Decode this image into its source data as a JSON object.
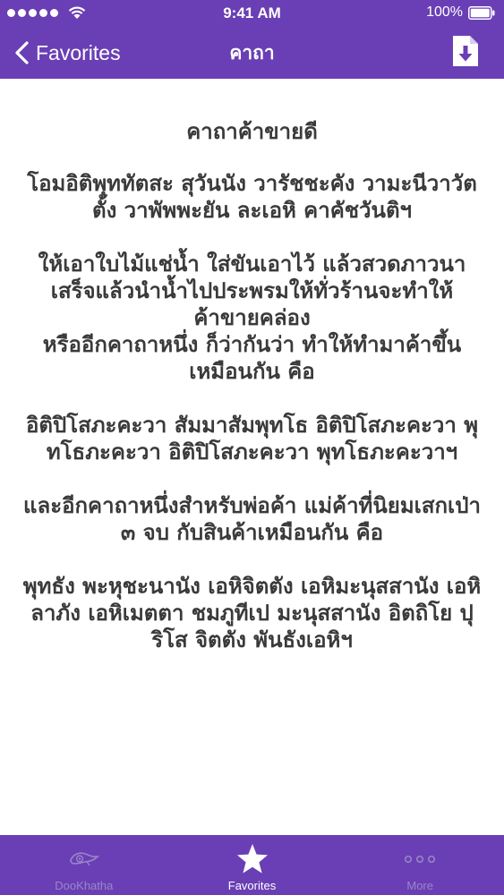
{
  "status_bar": {
    "time": "9:41 AM",
    "battery_percent": "100%",
    "signal_dots": 5
  },
  "nav": {
    "back_label": "Favorites",
    "title": "คาถา",
    "download_icon": "download-document-icon"
  },
  "content": {
    "title": "คาถาค้าขายดี",
    "paragraphs": [
      [
        "โอมอิติพุททัตสะ สุวันนัง วารัชชะคัง วามะนีวาวัต",
        "ตั้ง วาพัพพะยัน ละเอหิ คาคัชวันติฯ"
      ],
      [
        "ให้เอาใบไม้แช่น้ำ ใส่ขันเอาไว้ แล้วสวดภาวนา",
        "เสร็จแล้วนำน้ำไปประพรมให้ทั่วร้านจะทำให้",
        "ค้าขายคล่อง",
        "หรืออีกคาถาหนึ่ง ก็ว่ากันว่า ทำให้ทำมาค้าขึ้น",
        "เหมือนกัน คือ"
      ],
      [
        "อิติปิโสภะคะวา สัมมาสัมพุทโธ อิติปิโสภะคะวา พุ",
        "ทโธภะคะวา อิติปิโสภะคะวา พุทโธภะคะวาฯ"
      ],
      [
        "และอีกคาถาหนึ่งสำหรับพ่อค้า แม่ค้าที่นิยมเสกเป่า",
        "๓ จบ กับสินค้าเหมือนกัน คือ"
      ],
      [
        "พุทธัง พะหุชะนานัง เอหิจิตตัง เอหิมะนุสสานัง เอหิ",
        "ลาภัง เอหิเมตตา ชมภูทีเป มะนุสสานัง อิตถิโย ปุ",
        "ริโส จิตตัง พันธังเอหิฯ"
      ]
    ]
  },
  "tabs": [
    {
      "label": "DooKhatha",
      "icon": "conch-shell-icon",
      "active": false
    },
    {
      "label": "Favorites",
      "icon": "star-icon",
      "active": true
    },
    {
      "label": "More",
      "icon": "more-dots-icon",
      "active": false
    }
  ],
  "colors": {
    "bar_purple": "#6a3fb5",
    "text": "#3a3a3a",
    "inactive_tab": "#9a86c8"
  }
}
